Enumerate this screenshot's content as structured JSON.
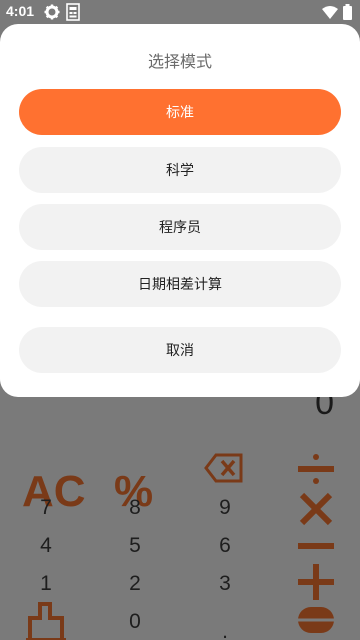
{
  "status_bar": {
    "time": "4:01"
  },
  "calculator": {
    "display_value": "0",
    "function_keys": [
      "AC",
      "%",
      "⌫"
    ],
    "digit_rows": [
      [
        "7",
        "8",
        "9"
      ],
      [
        "4",
        "5",
        "6"
      ],
      [
        "1",
        "2",
        "3"
      ],
      [
        "",
        "0",
        "."
      ]
    ],
    "operator_icons": [
      "divide-icon",
      "multiply-icon",
      "minus-icon",
      "plus-icon",
      "equals-icon"
    ],
    "accent_color": "#ff7130"
  },
  "dialog": {
    "title": "选择模式",
    "options": [
      {
        "label": "标准",
        "selected": true
      },
      {
        "label": "科学",
        "selected": false
      },
      {
        "label": "程序员",
        "selected": false
      },
      {
        "label": "日期相差计算",
        "selected": false
      }
    ],
    "cancel_label": "取消"
  }
}
